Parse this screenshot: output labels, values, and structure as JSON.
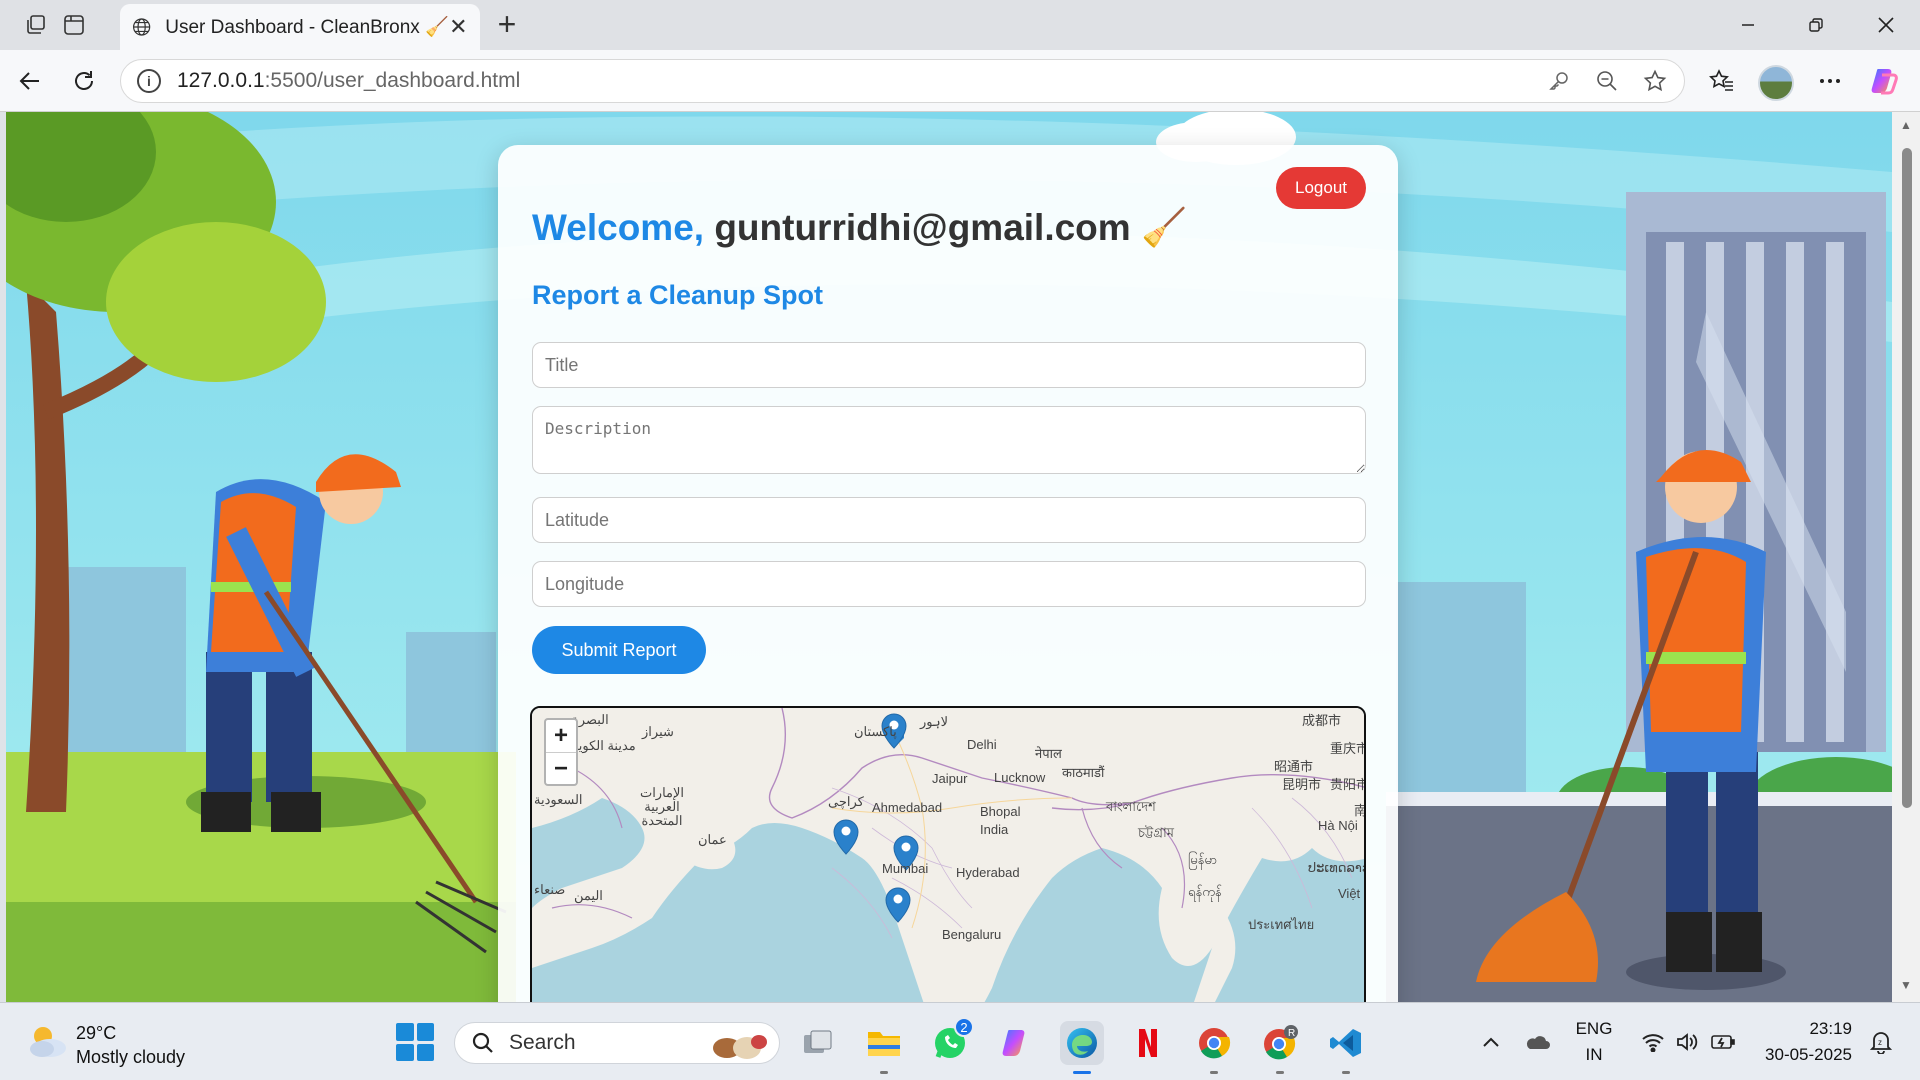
{
  "browser": {
    "tab_title": "User Dashboard - CleanBronx 🧹",
    "url_host": "127.0.0.1",
    "url_rest": ":5500/user_dashboard.html"
  },
  "dashboard": {
    "logout_label": "Logout",
    "welcome_prefix": "Welcome,",
    "user_email": "gunturridhi@gmail.com",
    "welcome_emoji": "🧹",
    "section_title": "Report a Cleanup Spot",
    "title_placeholder": "Title",
    "description_placeholder": "Description",
    "latitude_placeholder": "Latitude",
    "longitude_placeholder": "Longitude",
    "submit_label": "Submit Report"
  },
  "map": {
    "zoom_in": "+",
    "zoom_out": "−",
    "labels": {
      "delhi": "Delhi",
      "jaipur": "Jaipur",
      "lucknow": "Lucknow",
      "ahmedabad": "Ahmedabad",
      "bhopal": "Bhopal",
      "india": "India",
      "mumbai": "Mumbai",
      "hyderabad": "Hyderabad",
      "bengaluru": "Bengaluru",
      "nepal": "नेपाल",
      "kathmandu": "काठमाडौं",
      "pakistan": "پاکستان",
      "lahore": "لاہور",
      "karachi": "کراچی",
      "uae": "الإمارات العربية المتحدة",
      "oman": "عمان",
      "saudi": "السعودية",
      "yemen": "اليمن",
      "sanaa": "صنعاء",
      "shiraz": "شیراز",
      "basra": "البصرة",
      "kuwait": "مدينة الكويت",
      "chengdu": "成都市",
      "chongqing": "重庆市",
      "zhaotong": "昭通市",
      "kunming": "昆明市",
      "guiyang": "贵阳市",
      "hanoi": "Hà Nội",
      "viet": "Việt",
      "bangladesh": "বাংলাদেশ",
      "chittagong": "চট্টগ্রাম",
      "myanmar": "မြန်မာ",
      "yangon": "ရန်ကုန်",
      "laos": "ປະເທດລາວ",
      "thailand": "ประเทศไทย",
      "nan": "南"
    }
  },
  "taskbar": {
    "weather_temp": "29°C",
    "weather_desc": "Mostly cloudy",
    "search_label": "Search",
    "whatsapp_badge": "2",
    "lang_top": "ENG",
    "lang_bottom": "IN",
    "time": "23:19",
    "date": "30-05-2025"
  },
  "colors": {
    "accent_blue": "#1e88e5",
    "logout_red": "#e53935",
    "sky": "#88ddea"
  }
}
